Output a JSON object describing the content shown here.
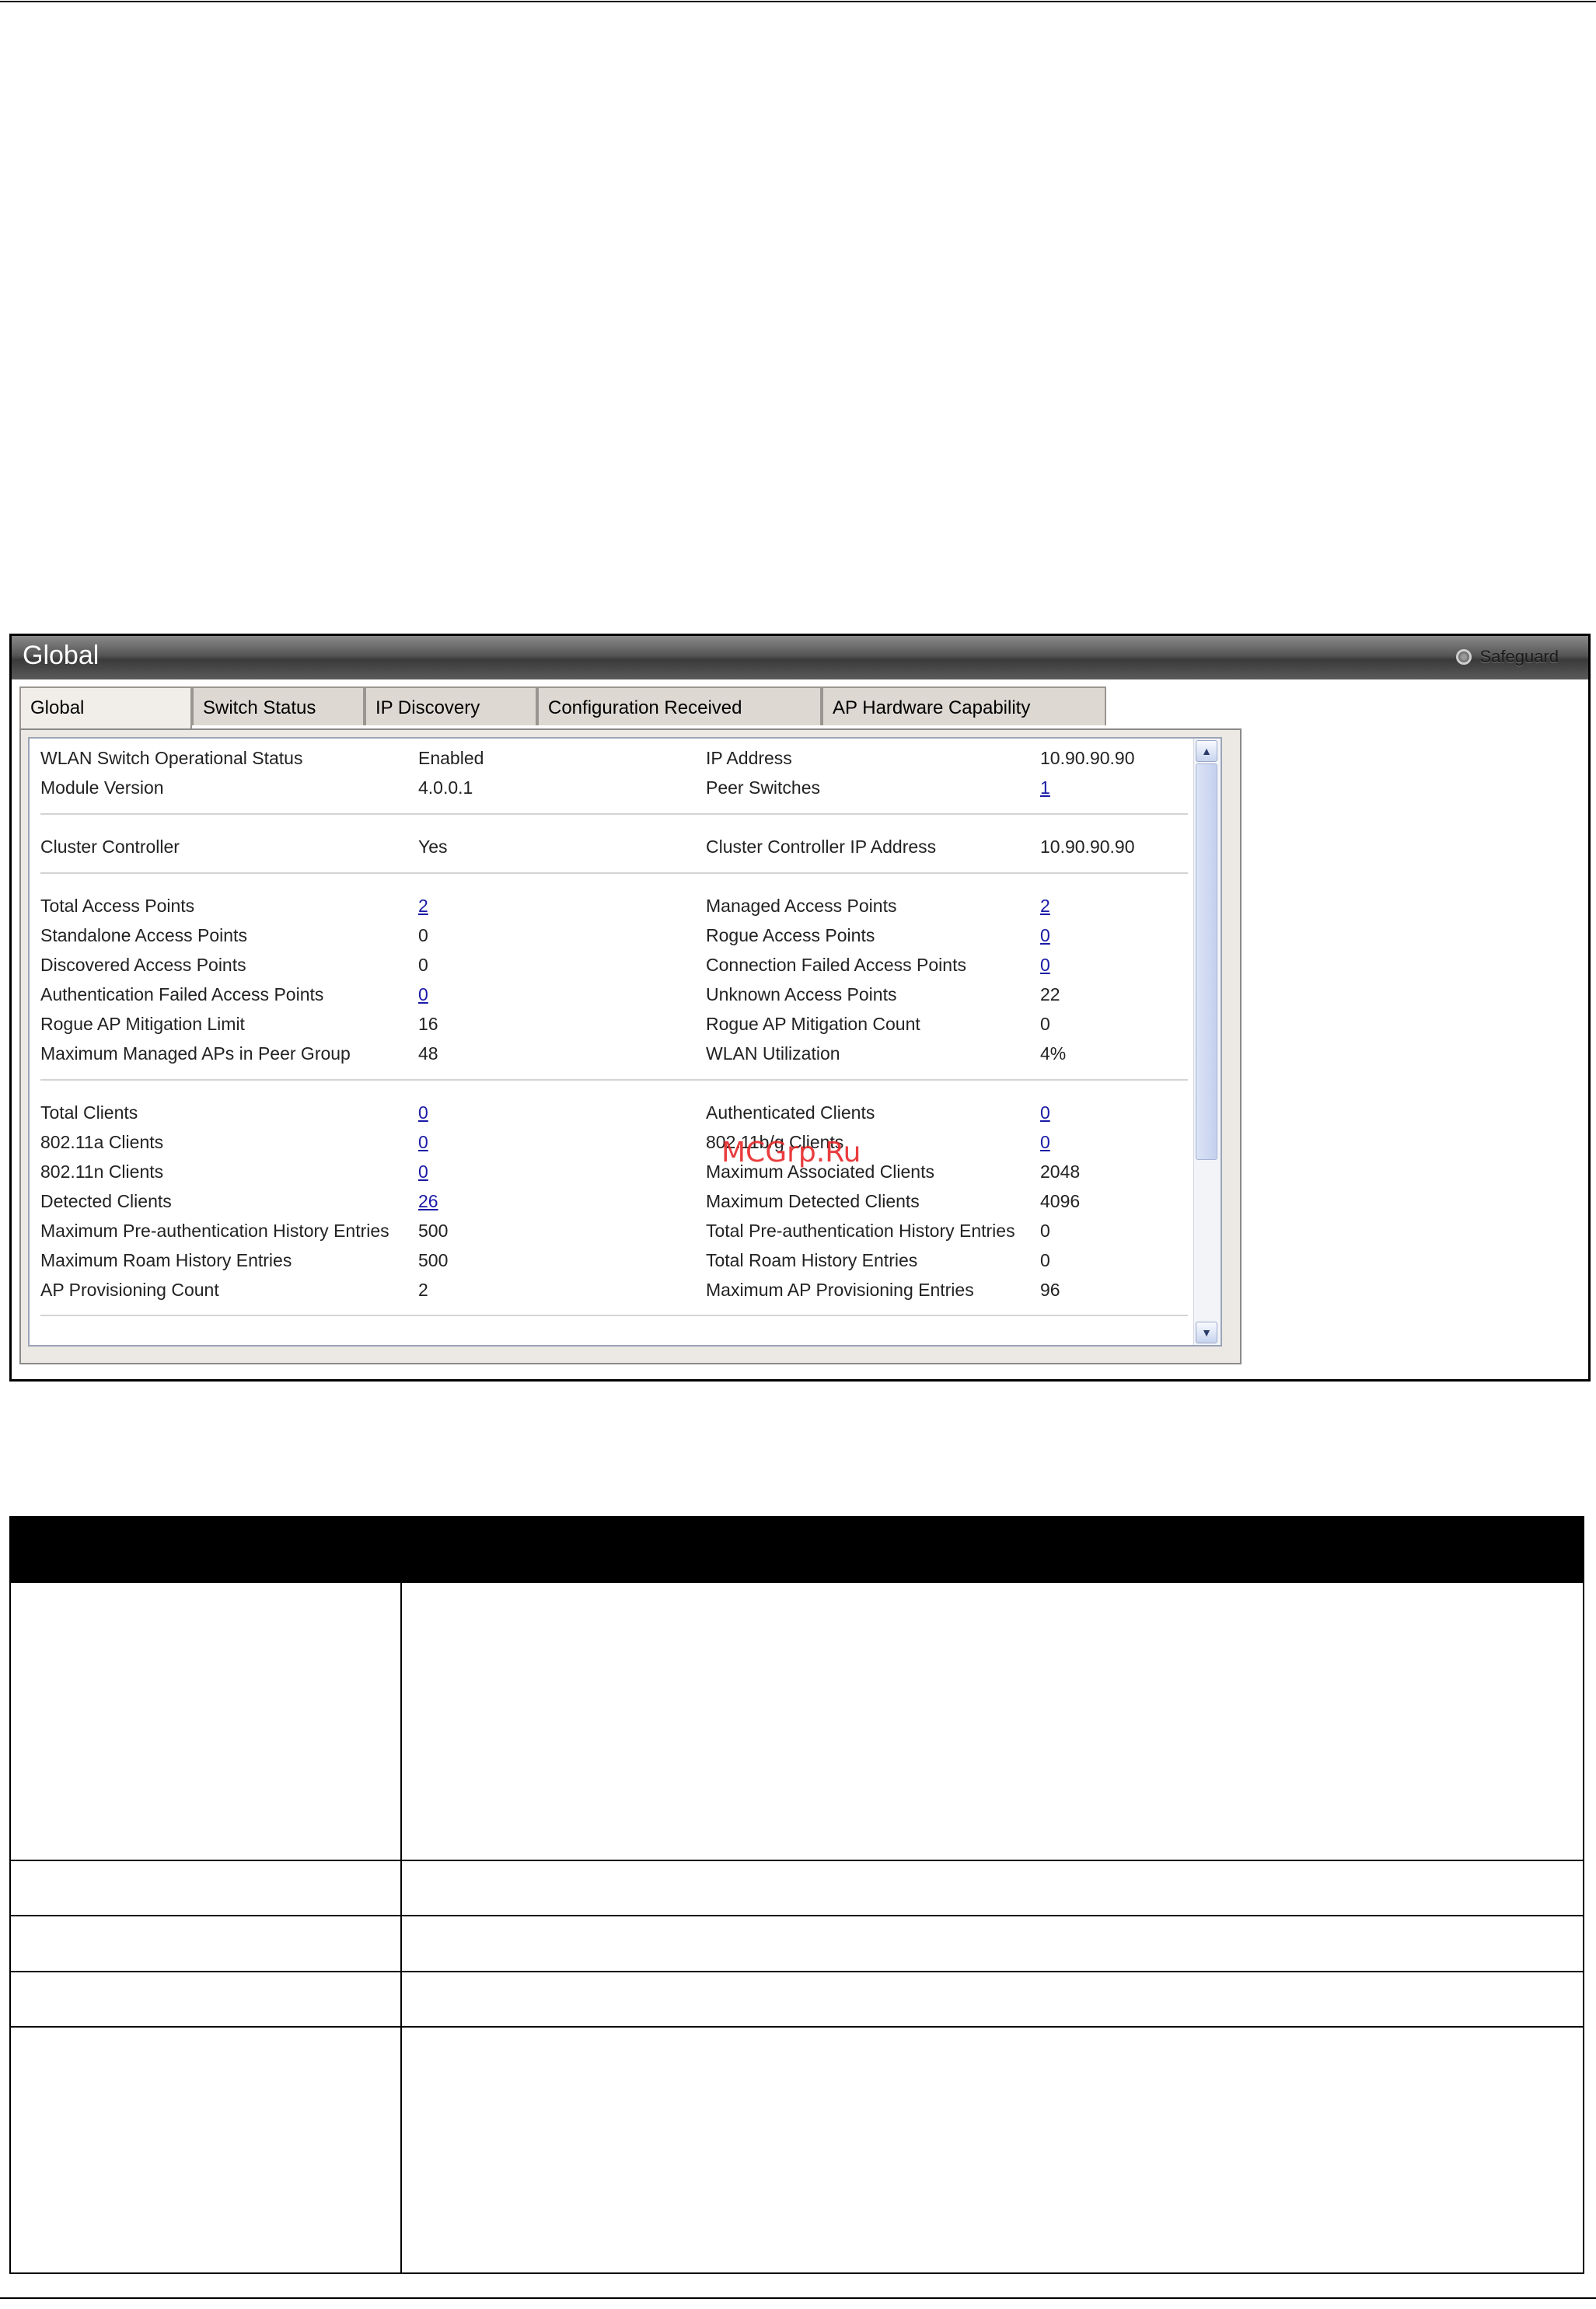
{
  "panel": {
    "title": "Global",
    "safeguard_label": "Safeguard",
    "tabs": [
      {
        "label": "Global",
        "active": true
      },
      {
        "label": "Switch Status",
        "active": false
      },
      {
        "label": "IP Discovery",
        "active": false
      },
      {
        "label": "Configuration Received",
        "active": false
      },
      {
        "label": "AP Hardware Capability",
        "active": false
      }
    ],
    "rows": [
      {
        "l_label": "WLAN Switch Operational Status",
        "l_value": "Enabled",
        "r_label": "IP Address",
        "r_value": "10.90.90.90"
      },
      {
        "l_label": "Module Version",
        "l_value": "4.0.0.1",
        "r_label": "Peer Switches",
        "r_value": "1"
      },
      {
        "l_label": "Cluster Controller",
        "l_value": "Yes",
        "r_label": "Cluster Controller IP Address",
        "r_value": "10.90.90.90"
      },
      {
        "l_label": "Total Access Points",
        "l_value": "2",
        "r_label": "Managed Access Points",
        "r_value": "2"
      },
      {
        "l_label": "Standalone Access Points",
        "l_value": "0",
        "r_label": "Rogue Access Points",
        "r_value": "0"
      },
      {
        "l_label": "Discovered Access Points",
        "l_value": "0",
        "r_label": "Connection Failed Access Points",
        "r_value": "0"
      },
      {
        "l_label": "Authentication Failed Access Points",
        "l_value": "0",
        "r_label": "Unknown Access Points",
        "r_value": "22"
      },
      {
        "l_label": "Rogue AP Mitigation Limit",
        "l_value": "16",
        "r_label": "Rogue AP Mitigation Count",
        "r_value": "0"
      },
      {
        "l_label": "Maximum Managed APs in Peer Group",
        "l_value": "48",
        "r_label": "WLAN Utilization",
        "r_value": "4%"
      },
      {
        "l_label": "Total Clients",
        "l_value": "0",
        "r_label": "Authenticated Clients",
        "r_value": "0"
      },
      {
        "l_label": "802.11a Clients",
        "l_value": "0",
        "r_label": "802.11b/g Clients",
        "r_value": "0"
      },
      {
        "l_label": "802.11n Clients",
        "l_value": "0",
        "r_label": "Maximum Associated Clients",
        "r_value": "2048"
      },
      {
        "l_label": "Detected Clients",
        "l_value": "26",
        "r_label": "Maximum Detected Clients",
        "r_value": "4096"
      },
      {
        "l_label": "Maximum Pre-authentication History Entries",
        "l_value": "500",
        "r_label": "Total Pre-authentication History Entries",
        "r_value": "0"
      },
      {
        "l_label": "Maximum Roam History Entries",
        "l_value": "500",
        "r_label": "Total Roam History Entries",
        "r_value": "0"
      },
      {
        "l_label": "AP Provisioning Count",
        "l_value": "2",
        "r_label": "Maximum AP Provisioning Entries",
        "r_value": "96"
      }
    ],
    "watermark": "MCGrp.Ru"
  }
}
